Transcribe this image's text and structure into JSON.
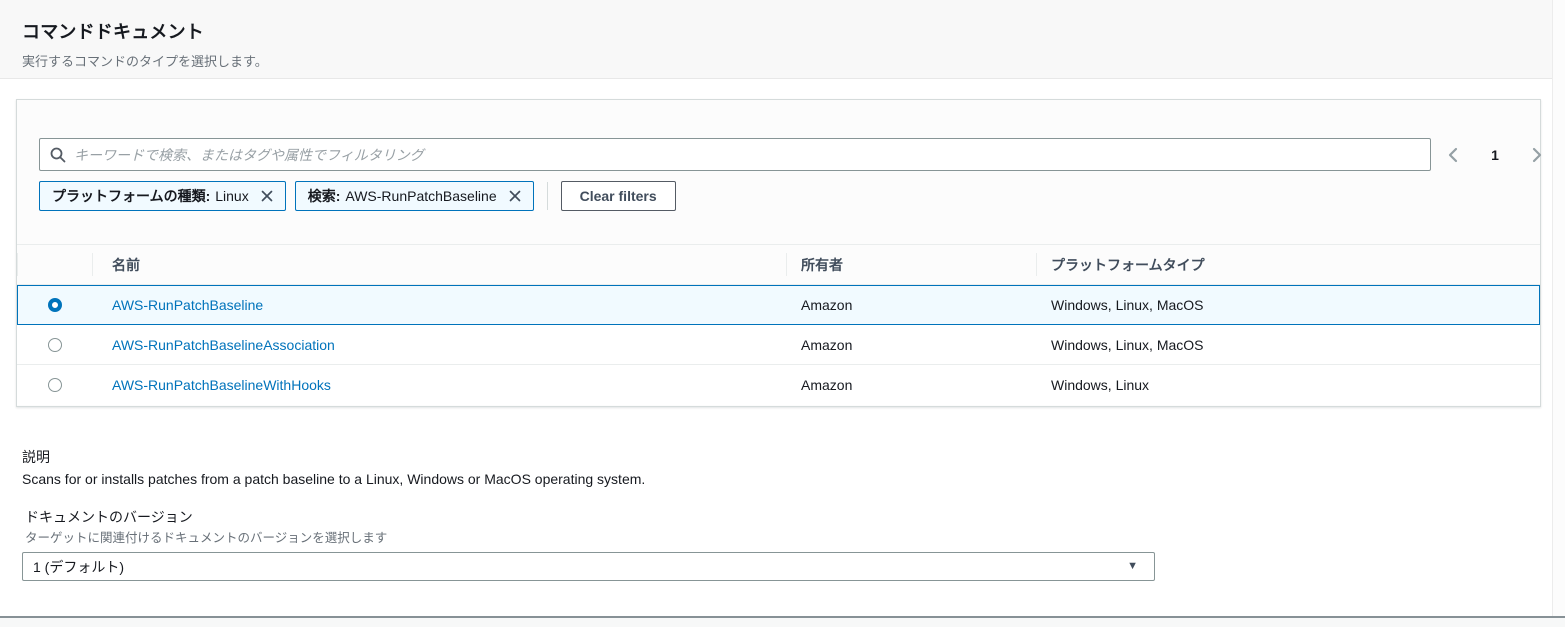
{
  "page": {
    "title": "コマンドドキュメント",
    "subtitle": "実行するコマンドのタイプを選択します。"
  },
  "toolbar": {
    "search_placeholder": "キーワードで検索、またはタグや属性でフィルタリング",
    "filters": [
      {
        "label": "プラットフォームの種類:",
        "value": "Linux"
      },
      {
        "label": "検索:",
        "value": "AWS-RunPatchBaseline"
      }
    ],
    "clear_filters_label": "Clear filters",
    "pagination": {
      "current_page": "1"
    }
  },
  "table": {
    "columns": [
      "名前",
      "所有者",
      "プラットフォームタイプ"
    ],
    "rows": [
      {
        "name": "AWS-RunPatchBaseline",
        "owner": "Amazon",
        "platform": "Windows, Linux, MacOS",
        "selected": true
      },
      {
        "name": "AWS-RunPatchBaselineAssociation",
        "owner": "Amazon",
        "platform": "Windows, Linux, MacOS",
        "selected": false
      },
      {
        "name": "AWS-RunPatchBaselineWithHooks",
        "owner": "Amazon",
        "platform": "Windows, Linux",
        "selected": false
      }
    ]
  },
  "description": {
    "label": "説明",
    "text": "Scans for or installs patches from a patch baseline to a Linux, Windows or MacOS operating system."
  },
  "document_version": {
    "label": "ドキュメントのバージョン",
    "hint": "ターゲットに関連付けるドキュメントのバージョンを選択します",
    "selected_option": "1 (デフォルト)"
  },
  "colors": {
    "accent_blue": "#0073bb",
    "selected_row_bg": "#f1faff",
    "chip_bg": "#f1faff",
    "chip_border": "#0073bb",
    "header_bg": "#f8f8f8",
    "panel_border": "#d5dbdb",
    "muted_text": "#687078"
  }
}
